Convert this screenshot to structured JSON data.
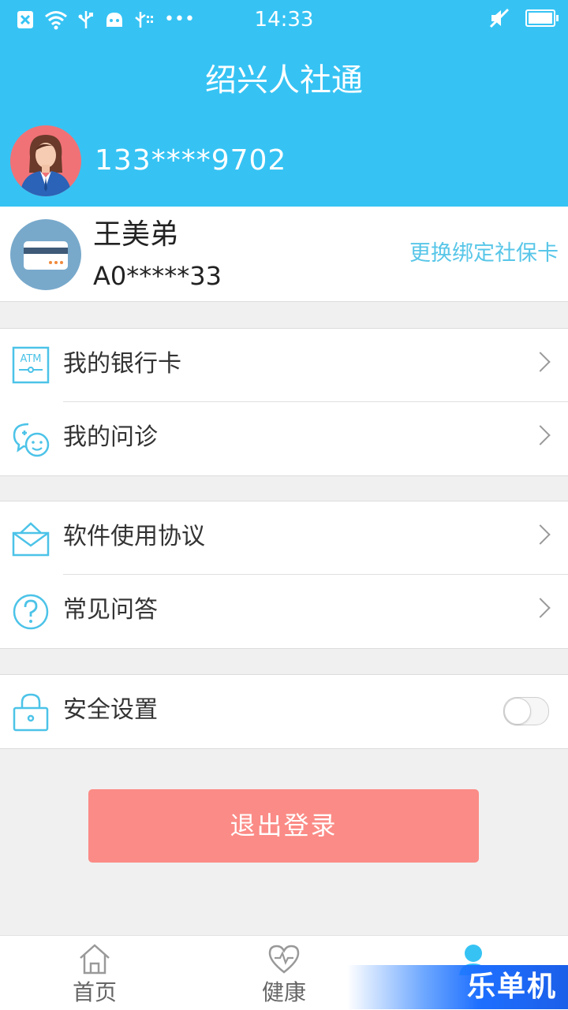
{
  "status_bar": {
    "time": "14:33",
    "left_icons": [
      "sim-off-icon",
      "wifi-icon",
      "usb-icon",
      "android-debug-icon",
      "usb-tether-icon",
      "more-dots-icon"
    ],
    "right_icons": [
      "mute-icon",
      "battery-icon"
    ]
  },
  "header": {
    "title": "绍兴人社通",
    "phone": "133****9702",
    "background_color": "#36c3f4"
  },
  "card": {
    "name": "王美弟",
    "id": "A0*****33",
    "change_link": "更换绑定社保卡"
  },
  "menu": {
    "bank_card": "我的银行卡",
    "consultation": "我的问诊",
    "agreement": "软件使用协议",
    "faq": "常见问答",
    "security": "安全设置",
    "atm_text": "ATM",
    "security_toggle_on": false
  },
  "logout": {
    "label": "退出登录",
    "color": "#fb8b86"
  },
  "tabbar": {
    "home": "首页",
    "health": "健康",
    "active_tab": "mine"
  },
  "watermark": {
    "text": "乐单机"
  }
}
